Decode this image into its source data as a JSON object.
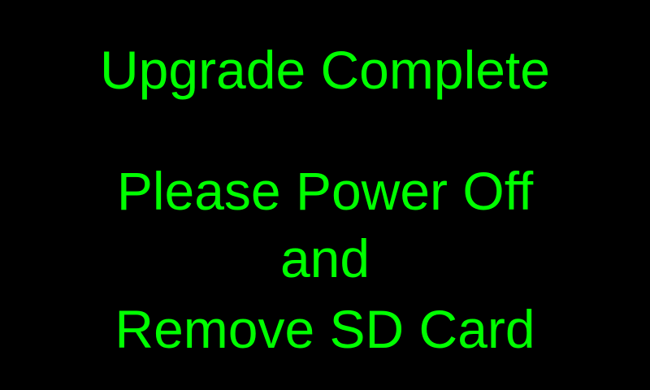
{
  "screen": {
    "title": "Upgrade Complete",
    "message_lines": [
      "Please Power Off",
      "and",
      "Remove SD Card"
    ],
    "colors": {
      "background": "#000000",
      "text": "#00ff00"
    }
  }
}
